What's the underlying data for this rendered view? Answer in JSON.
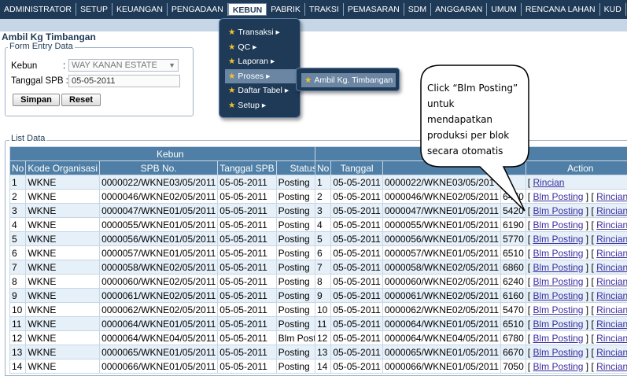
{
  "topbar": {
    "items": [
      {
        "label": "ADMINISTRATOR"
      },
      {
        "label": "SETUP"
      },
      {
        "label": "KEUANGAN"
      },
      {
        "label": "PENGADAAN"
      },
      {
        "label": "KEBUN",
        "active": true
      },
      {
        "label": "PABRIK"
      },
      {
        "label": "TRAKSI"
      },
      {
        "label": "PEMASARAN"
      },
      {
        "label": "SDM"
      },
      {
        "label": "ANGGARAN"
      },
      {
        "label": "UMUM"
      },
      {
        "label": "RENCANA LAHAN"
      },
      {
        "label": "KUD"
      },
      {
        "label": "GUDAN"
      }
    ]
  },
  "page": {
    "title": "Ambil Kg Timbangan"
  },
  "form": {
    "legend": "Form Entry Data",
    "kebun_label": "Kebun",
    "kebun_colon": ":",
    "kebun_value": "WAY KANAN ESTATE",
    "tanggal_label": "Tanggal SPB :",
    "tanggal_value": "05-05-2011",
    "simpan_label": "Simpan",
    "reset_label": "Reset"
  },
  "dropdown": {
    "items": [
      {
        "label": "Transaksi",
        "arrow": "▸"
      },
      {
        "label": "QC",
        "arrow": "▸"
      },
      {
        "label": "Laporan",
        "arrow": "▸"
      },
      {
        "label": "Proses",
        "arrow": "▸"
      },
      {
        "label": "Daftar Tabel",
        "arrow": "▸"
      },
      {
        "label": "Setup",
        "arrow": "▸"
      }
    ],
    "star": "★",
    "submenu_label": "Ambil Kg. Timbangan"
  },
  "callout": {
    "lines": [
      "Click “Blm Posting”",
      "untuk",
      "mendapatkan",
      "produksi per blok",
      "secara otomatis"
    ]
  },
  "list": {
    "legend": "List Data",
    "group_left": "Kebun",
    "left_headers": [
      "No",
      "Kode Organisasi",
      "SPB No.",
      "Tanggal SPB",
      "Status"
    ],
    "right_headers": [
      "No",
      "Tanggal",
      "",
      "",
      "Action"
    ],
    "left_rows": [
      [
        "1",
        "WKNE",
        "0000022/WKNE03/05/2011",
        "05-05-2011",
        "Posting"
      ],
      [
        "2",
        "WKNE",
        "0000046/WKNE02/05/2011",
        "05-05-2011",
        "Posting"
      ],
      [
        "3",
        "WKNE",
        "0000047/WKNE01/05/2011",
        "05-05-2011",
        "Posting"
      ],
      [
        "4",
        "WKNE",
        "0000055/WKNE01/05/2011",
        "05-05-2011",
        "Posting"
      ],
      [
        "5",
        "WKNE",
        "0000056/WKNE01/05/2011",
        "05-05-2011",
        "Posting"
      ],
      [
        "6",
        "WKNE",
        "0000057/WKNE01/05/2011",
        "05-05-2011",
        "Posting"
      ],
      [
        "7",
        "WKNE",
        "0000058/WKNE02/05/2011",
        "05-05-2011",
        "Posting"
      ],
      [
        "8",
        "WKNE",
        "0000060/WKNE02/05/2011",
        "05-05-2011",
        "Posting"
      ],
      [
        "9",
        "WKNE",
        "0000061/WKNE02/05/2011",
        "05-05-2011",
        "Posting"
      ],
      [
        "10",
        "WKNE",
        "0000062/WKNE02/05/2011",
        "05-05-2011",
        "Posting"
      ],
      [
        "11",
        "WKNE",
        "0000064/WKNE01/05/2011",
        "05-05-2011",
        "Posting"
      ],
      [
        "12",
        "WKNE",
        "0000064/WKNE04/05/2011",
        "05-05-2011",
        "Blm Posting"
      ],
      [
        "13",
        "WKNE",
        "0000065/WKNE01/05/2011",
        "05-05-2011",
        "Posting"
      ],
      [
        "14",
        "WKNE",
        "0000066/WKNE01/05/2011",
        "05-05-2011",
        "Posting"
      ]
    ],
    "right_rows": [
      [
        "1",
        "05-05-2011",
        "0000022/WKNE03/05/201",
        "",
        "",
        "Rincian"
      ],
      [
        "2",
        "05-05-2011",
        "0000046/WKNE02/05/2011",
        "6470",
        "Blm Posting",
        "Rincian"
      ],
      [
        "3",
        "05-05-2011",
        "0000047/WKNE01/05/2011",
        "5420",
        "Blm Posting",
        "Rincian"
      ],
      [
        "4",
        "05-05-2011",
        "0000055/WKNE01/05/2011",
        "6190",
        "Blm Posting",
        "Rincian"
      ],
      [
        "5",
        "05-05-2011",
        "0000056/WKNE01/05/2011",
        "5770",
        "Blm Posting",
        "Rincian"
      ],
      [
        "6",
        "05-05-2011",
        "0000057/WKNE01/05/2011",
        "6510",
        "Blm Posting",
        "Rincian"
      ],
      [
        "7",
        "05-05-2011",
        "0000058/WKNE02/05/2011",
        "6860",
        "Blm Posting",
        "Rincian"
      ],
      [
        "8",
        "05-05-2011",
        "0000060/WKNE02/05/2011",
        "6240",
        "Blm Posting",
        "Rincian"
      ],
      [
        "9",
        "05-05-2011",
        "0000061/WKNE02/05/2011",
        "6160",
        "Blm Posting",
        "Rincian"
      ],
      [
        "10",
        "05-05-2011",
        "0000062/WKNE02/05/2011",
        "5470",
        "Blm Posting",
        "Rincian"
      ],
      [
        "11",
        "05-05-2011",
        "0000064/WKNE01/05/2011",
        "6510",
        "Blm Posting",
        "Rincian"
      ],
      [
        "12",
        "05-05-2011",
        "0000064/WKNE04/05/2011",
        "6780",
        "Blm Posting",
        "Rincian"
      ],
      [
        "13",
        "05-05-2011",
        "0000065/WKNE01/05/2011",
        "6670",
        "Blm Posting",
        "Rincian"
      ],
      [
        "14",
        "05-05-2011",
        "0000066/WKNE01/05/2011",
        "7050",
        "Blm Posting",
        "Rincian"
      ]
    ]
  }
}
